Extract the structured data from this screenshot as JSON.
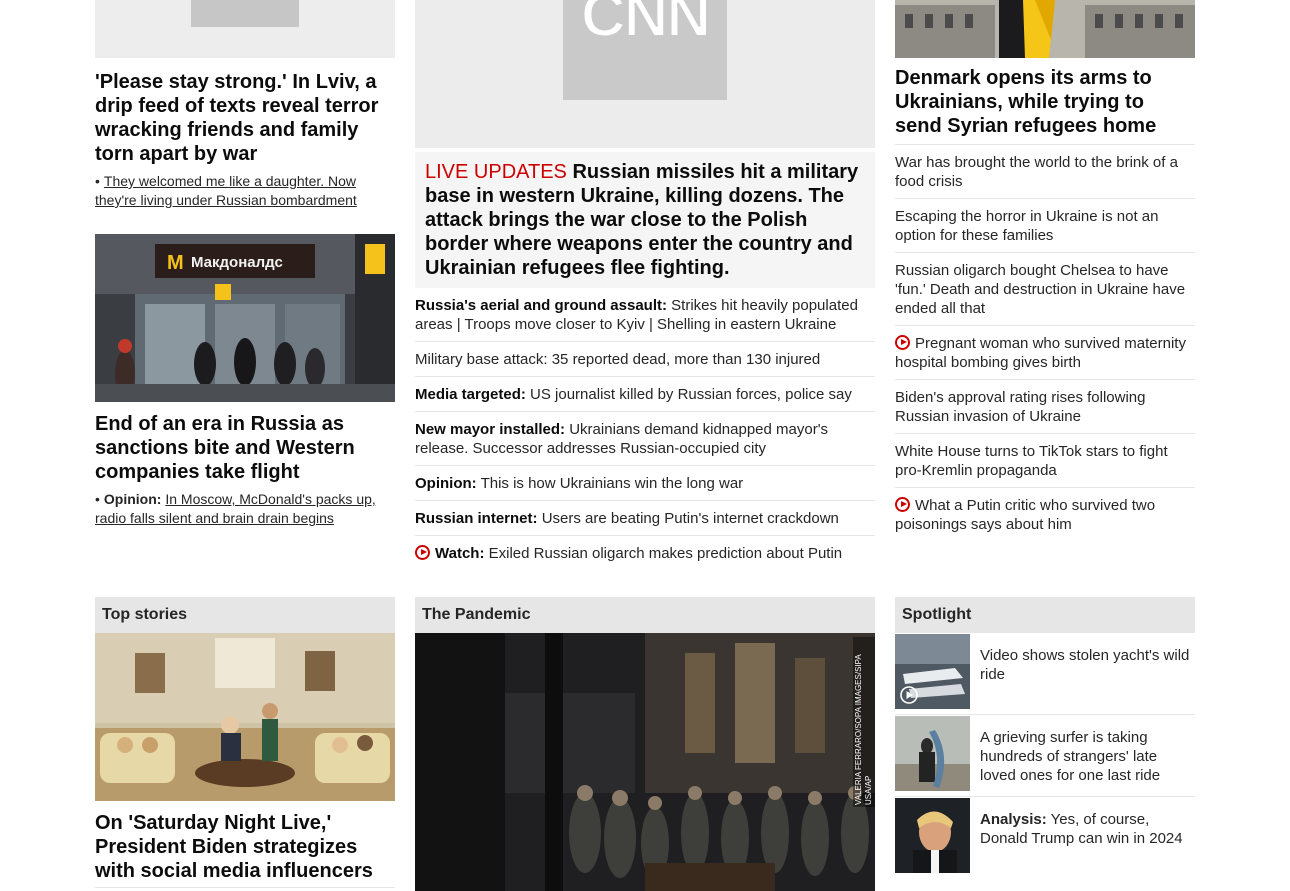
{
  "left": {
    "story1": {
      "headline": "'Please stay strong.' In Lviv, a drip feed of texts reveal terror wracking friends and family torn apart by war",
      "sub_link": "They welcomed me like a daughter. Now they're living under Russian bombardment"
    },
    "story2": {
      "storefront_sign": "Макдоналдс",
      "headline": "End of an era in Russia as sanctions bite and Western companies take flight",
      "sub_label": "Opinion:",
      "sub_link": "In Moscow, McDonald's packs up, radio falls silent and brain drain begins"
    }
  },
  "mid": {
    "logo_text": "CNN",
    "live_label": "LIVE UPDATES",
    "headline": "Russian missiles hit a military base in western Ukraine, killing dozens. The attack brings the war close to the Polish border where weapons enter the country and Ukrainian refugees flee fighting.",
    "items": [
      {
        "label": "Russia's aerial and ground assault:",
        "text": "Strikes hit heavily populated areas | Troops move closer to Kyiv | Shelling in eastern Ukraine",
        "video": false
      },
      {
        "label": "",
        "text": "Military base attack: 35 reported dead, more than 130 injured",
        "video": false
      },
      {
        "label": "Media targeted:",
        "text": "US journalist killed by Russian forces, police say",
        "video": false
      },
      {
        "label": "New mayor installed:",
        "text": "Ukrainians demand kidnapped mayor's release. Successor addresses Russian-occupied city",
        "video": false
      },
      {
        "label": "Opinion:",
        "text": "This is how Ukrainians win the long war",
        "video": false
      },
      {
        "label": "Russian internet:",
        "text": "Users are beating Putin's internet crackdown",
        "video": false
      },
      {
        "label": "Watch:",
        "text": "Exiled Russian oligarch makes prediction about Putin",
        "video": true
      }
    ]
  },
  "right": {
    "headline": "Denmark opens its arms to Ukrainians, while trying to send Syrian refugees home",
    "items": [
      {
        "text": "War has brought the world to the brink of a food crisis",
        "video": false
      },
      {
        "text": "Escaping the horror in Ukraine is not an option for these families",
        "video": false
      },
      {
        "text": "Russian oligarch bought Chelsea to have 'fun.' Death and destruction in Ukraine have ended all that",
        "video": false
      },
      {
        "text": "Pregnant woman who survived maternity hospital bombing gives birth",
        "video": true
      },
      {
        "text": "Biden's approval rating rises following Russian invasion of Ukraine",
        "video": false
      },
      {
        "text": "White House turns to TikTok stars to fight pro-Kremlin propaganda",
        "video": false
      },
      {
        "text": "What a Putin critic who survived two poisonings says about him",
        "video": true
      }
    ]
  },
  "sections": {
    "top_stories": {
      "title": "Top stories",
      "headline": "On 'Saturday Night Live,' President Biden strategizes with social media influencers"
    },
    "pandemic": {
      "title": "The Pandemic",
      "photo_credit": "VALERIA FERRARO/SOPA IMAGES/SIPA USA/AP"
    },
    "spotlight": {
      "title": "Spotlight",
      "items": [
        {
          "label": "",
          "text": "Video shows stolen yacht's wild ride",
          "video": true
        },
        {
          "label": "",
          "text": "A grieving surfer is taking hundreds of strangers' late loved ones for one last ride",
          "video": false
        },
        {
          "label": "Analysis:",
          "text": "Yes, of course, Donald Trump can win in 2024",
          "video": false
        }
      ]
    }
  },
  "colors": {
    "accent_red": "#cc0000",
    "header_gray": "#e6e6e6",
    "headline_bg": "#f5f5f5"
  }
}
